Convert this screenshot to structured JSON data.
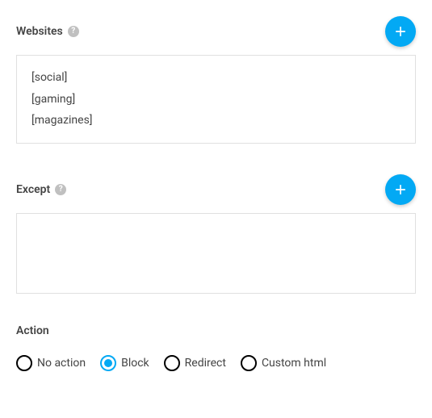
{
  "websites": {
    "label": "Websites",
    "help_symbol": "?",
    "items": [
      "[social]",
      "[gaming]",
      "[magazines]"
    ]
  },
  "except": {
    "label": "Except",
    "help_symbol": "?",
    "items": []
  },
  "action": {
    "label": "Action",
    "selected": "block",
    "options": [
      {
        "key": "no_action",
        "label": "No action"
      },
      {
        "key": "block",
        "label": "Block"
      },
      {
        "key": "redirect",
        "label": "Redirect"
      },
      {
        "key": "custom_html",
        "label": "Custom html"
      }
    ]
  },
  "colors": {
    "accent": "#03a9f4"
  }
}
